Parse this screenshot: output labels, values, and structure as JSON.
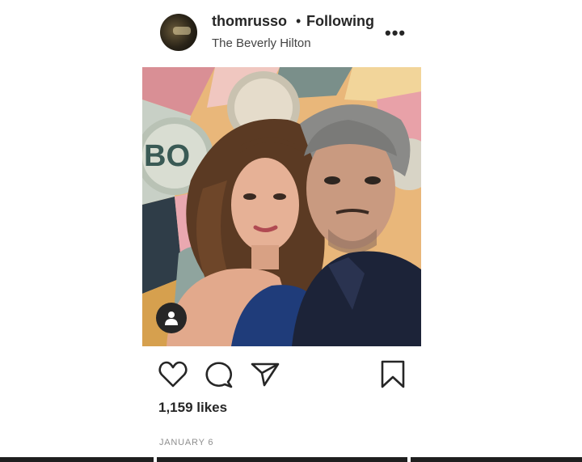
{
  "post": {
    "username": "thomrusso",
    "separator": "•",
    "follow_status": "Following",
    "location": "The Beverly Hilton",
    "more_label": "•••",
    "likes": "1,159 likes",
    "date": "JANUARY 6"
  },
  "icons": {
    "more": "more-options-icon",
    "tag": "user-tag-icon",
    "like": "heart-icon",
    "comment": "comment-icon",
    "share": "paper-plane-icon",
    "save": "bookmark-icon"
  },
  "colors": {
    "text": "#262626",
    "muted": "#8e8e8e",
    "background": "#ffffff"
  }
}
